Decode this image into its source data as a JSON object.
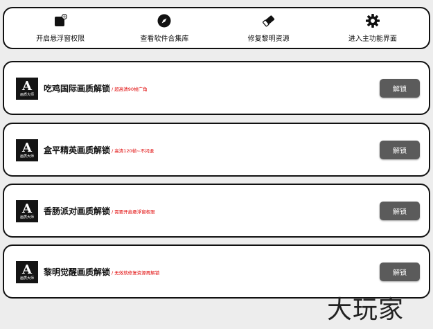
{
  "toolbar": {
    "items": [
      {
        "label": "开启悬浮窗权限",
        "icon": "floating-window-icon"
      },
      {
        "label": "查看软件合集库",
        "icon": "compass-icon"
      },
      {
        "label": "修复黎明资源",
        "icon": "eraser-icon"
      },
      {
        "label": "进入主功能界面",
        "icon": "gear-icon"
      }
    ]
  },
  "cards": [
    {
      "title": "吃鸡国际画质解锁",
      "note": "/ 超高清90帧广角",
      "button": "解锁"
    },
    {
      "title": "盒平精英画质解锁",
      "note": "/ 高清120帧~不闪退",
      "button": "解锁"
    },
    {
      "title": "香肠派对画质解锁",
      "note": "/ 需要开启悬浮窗权限",
      "button": "解锁"
    },
    {
      "title": "黎明觉醒画质解锁",
      "note": "/ 无效就修复资源再解锁",
      "button": "解锁"
    }
  ],
  "logo": {
    "big": "A",
    "small": "画质大师"
  },
  "watermark": "大玩家",
  "colors": {
    "note": "#e00000",
    "button": "#5b5b5b",
    "background": "#ededed"
  }
}
